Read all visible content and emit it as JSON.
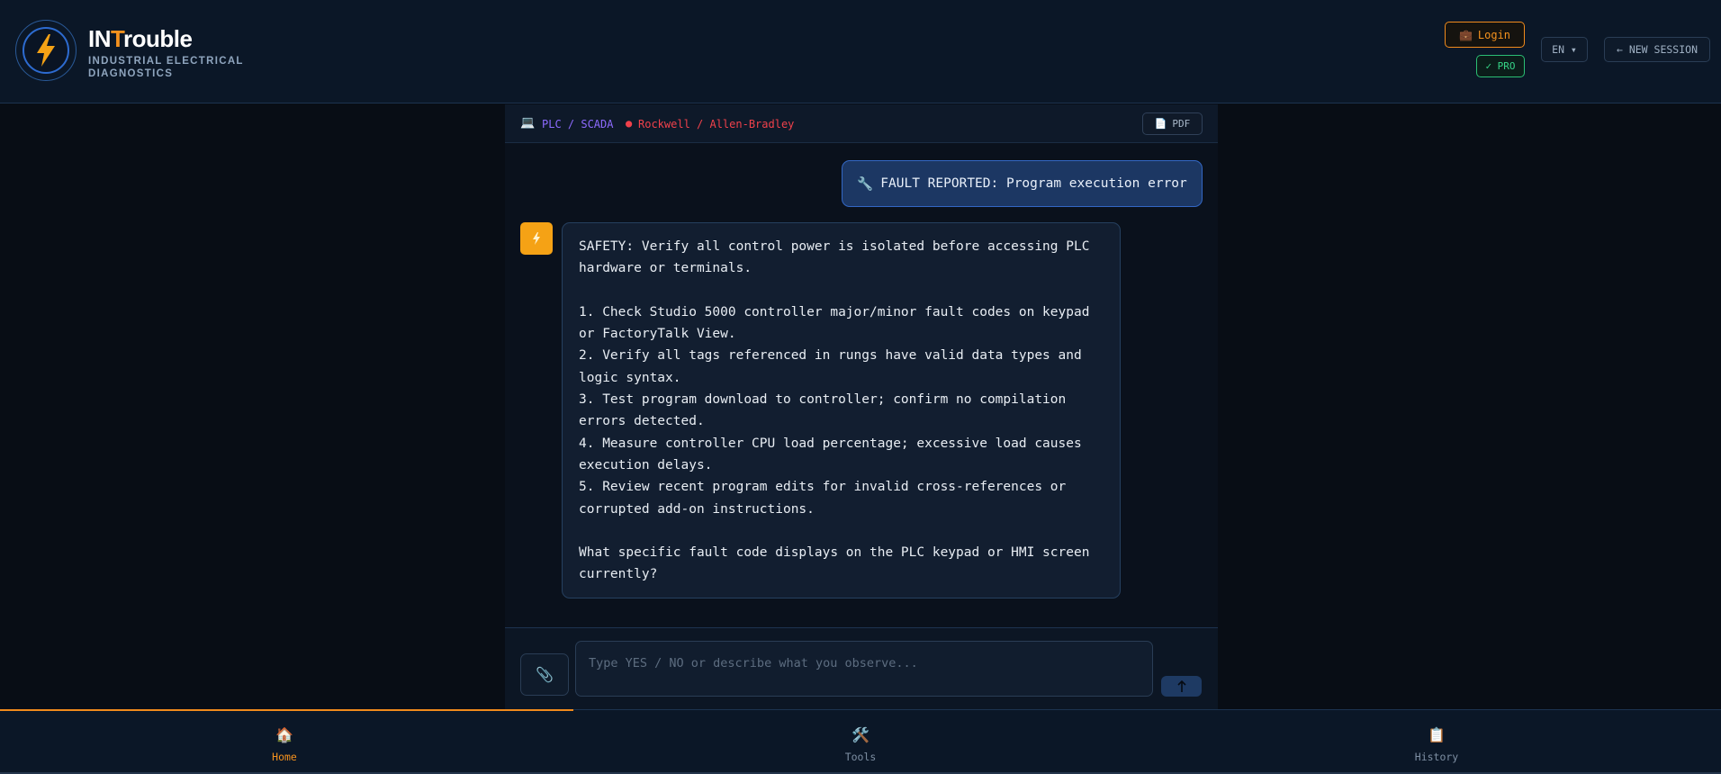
{
  "app": {
    "title_prefix": "IN",
    "title_accent": "T",
    "title_suffix": "rouble",
    "subtitle": "INDUSTRIAL ELECTRICAL DIAGNOSTICS",
    "accent_color": "#f5921e"
  },
  "header": {
    "login_label": "Login",
    "pro_label": "✓ PRO",
    "lang_label": "EN ▾",
    "new_session_label": "← NEW SESSION"
  },
  "breadcrumb": {
    "category": "PLC / SCADA",
    "brand": "Rockwell / Allen-Bradley",
    "pdf_label": "PDF"
  },
  "chat": {
    "user_message": "FAULT REPORTED: Program execution error",
    "bot_message": {
      "safety": "SAFETY: Verify all control power is isolated before accessing PLC hardware or terminals.",
      "steps": [
        "1. Check Studio 5000 controller major/minor fault codes on keypad or FactoryTalk View.",
        "2. Verify all tags referenced in rungs have valid data types and logic syntax.",
        "3. Test program download to controller; confirm no compilation errors detected.",
        "4. Measure controller CPU load percentage; excessive load causes execution delays.",
        "5. Review recent program edits for invalid cross-references or corrupted add-on instructions."
      ],
      "question": "What specific fault code displays on the PLC keypad or HMI screen currently?"
    }
  },
  "composer": {
    "placeholder": "Type YES / NO or describe what you observe...",
    "value": ""
  },
  "nav": {
    "items": [
      {
        "label": "Home",
        "icon": "house-icon",
        "active": true
      },
      {
        "label": "Tools",
        "icon": "tools-icon",
        "active": false
      },
      {
        "label": "History",
        "icon": "clipboard-icon",
        "active": false
      }
    ]
  }
}
